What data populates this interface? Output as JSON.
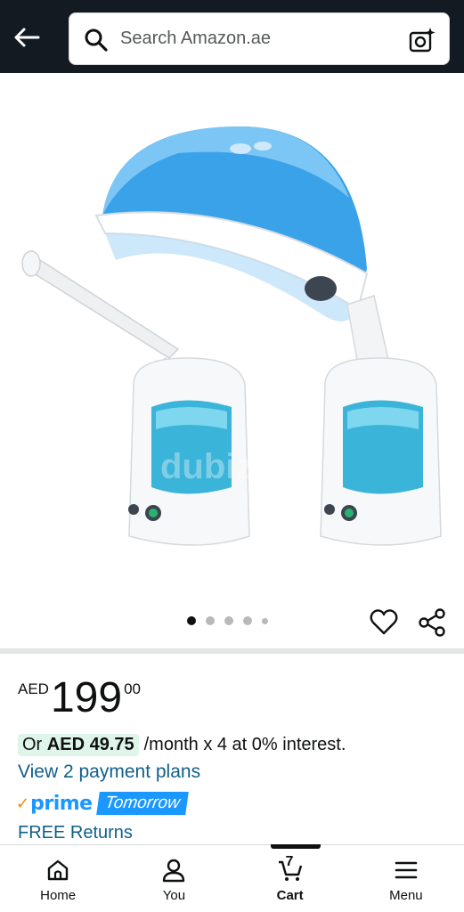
{
  "header": {
    "search_placeholder": "Search Amazon.ae",
    "back_icon": "arrow-left-icon",
    "camera_icon": "camera-sparkle-icon"
  },
  "gallery": {
    "watermark": "dubizzle",
    "image_count": 5,
    "active_index": 0
  },
  "price": {
    "currency": "AED",
    "whole": "199",
    "fraction": "00"
  },
  "installment": {
    "prefix": "Or ",
    "amount": "AED 49.75",
    "suffix": "/month x 4 at 0% interest."
  },
  "plans_link": "View 2 payment plans",
  "prime": {
    "logo": "prime",
    "delivery": "Tomorrow"
  },
  "returns_link": "FREE Returns",
  "nav": {
    "home": "Home",
    "you": "You",
    "cart": "Cart",
    "cart_count": "7",
    "menu": "Menu"
  },
  "colors": {
    "topbar": "#131a22",
    "link": "#0f5f8a",
    "prime_blue": "#1a98ff",
    "installment_bg": "#dff5e9"
  }
}
